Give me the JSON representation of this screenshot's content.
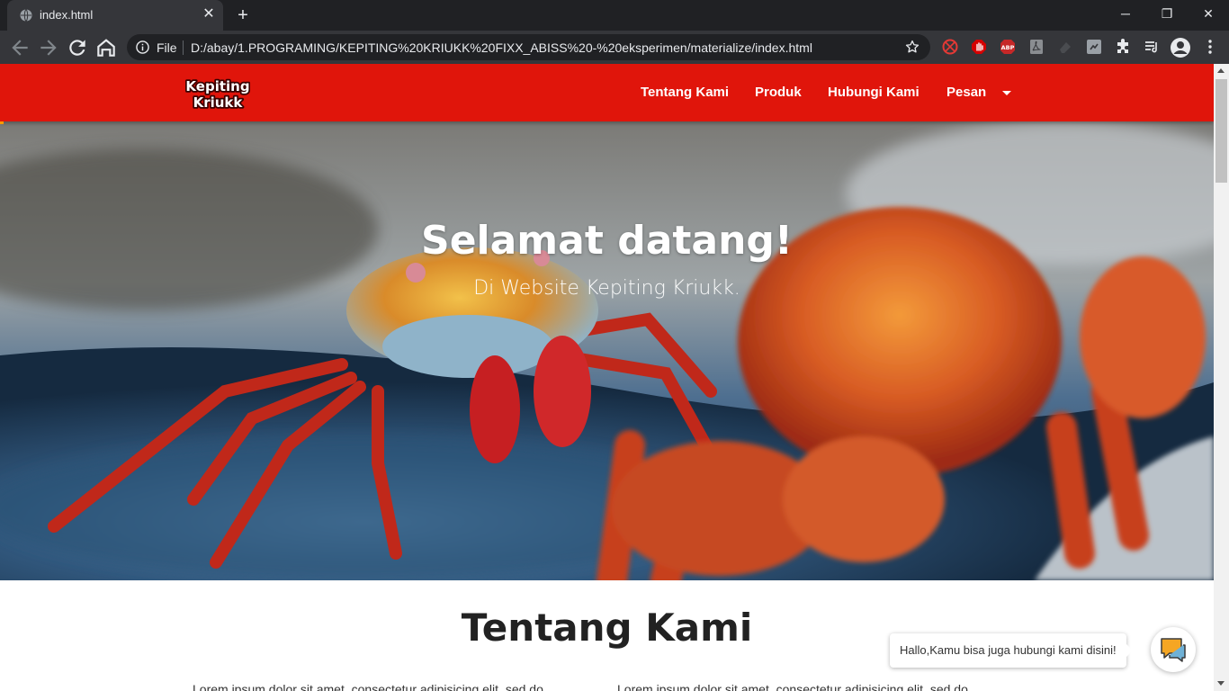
{
  "browser": {
    "tab_title": "index.html",
    "tab_close": "✕",
    "new_tab": "+",
    "window_controls": {
      "minimize": "─",
      "restore": "❐",
      "close": "✕"
    },
    "address": {
      "scheme_label": "File",
      "url": "D:/abay/1.PROGRAMING/KEPITING%20KRIUKK%20FIXX_ABISS%20-%20eksperimen/materialize/index.html"
    },
    "extension_badge": "8",
    "icons": [
      "back-icon",
      "forward-icon",
      "reload-icon",
      "home-icon",
      "info-icon",
      "star-icon",
      "puzzle-icon",
      "media-icon",
      "profile-icon",
      "menu-icon"
    ]
  },
  "site": {
    "brand": {
      "logo_line1": "Kepiting",
      "logo_line2": "Kriukk"
    },
    "nav": {
      "items": [
        {
          "label": "Tentang Kami"
        },
        {
          "label": "Produk"
        },
        {
          "label": "Hubungi Kami"
        },
        {
          "label": "Pesan"
        }
      ]
    },
    "hero": {
      "title": "Selamat datang!",
      "subtitle": "Di Website Kepiting Kriukk."
    },
    "about": {
      "title": "Tentang Kami",
      "col1_text": "Lorem ipsum dolor sit amet, consectetur adipisicing elit, sed do",
      "col2_text": "Lorem ipsum dolor sit amet, consectetur adipisicing elit, sed do"
    },
    "chat": {
      "message": "Hallo,Kamu bisa juga hubungi kami disini!"
    },
    "colors": {
      "nav_red": "#e0150b",
      "chrome_dark": "#202124",
      "chrome_toolbar": "#35363a",
      "chat_icon_orange": "#f5a623"
    }
  }
}
